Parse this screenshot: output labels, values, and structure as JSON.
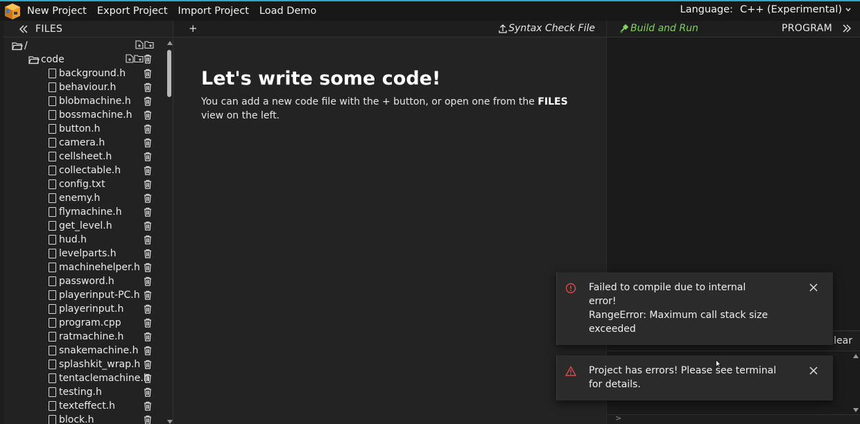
{
  "menu": {
    "items": [
      "New Project",
      "Export Project",
      "Import Project",
      "Load Demo"
    ],
    "language_label": "Language:",
    "language_value": "C++ (Experimental)"
  },
  "files_panel": {
    "title": "FILES",
    "root": "/",
    "folder": "code",
    "files": [
      "background.h",
      "behaviour.h",
      "blobmachine.h",
      "bossmachine.h",
      "button.h",
      "camera.h",
      "cellsheet.h",
      "collectable.h",
      "config.txt",
      "enemy.h",
      "flymachine.h",
      "get_level.h",
      "hud.h",
      "levelparts.h",
      "machinehelper.h",
      "password.h",
      "playerinput-PC.h",
      "playerinput.h",
      "program.cpp",
      "ratmachine.h",
      "snakemachine.h",
      "splashkit_wrap.h",
      "tentaclemachine.h",
      "testing.h",
      "texteffect.h",
      "block.h"
    ]
  },
  "editor": {
    "add_tab": "+",
    "syntax_check": "Syntax Check File",
    "welcome_title": "Let's write some code!",
    "welcome_text_1": "You can add a new code file with the + button, or open one from the ",
    "welcome_text_bold": "FILES",
    "welcome_text_2": " view on the left."
  },
  "program_panel": {
    "build_run": "Build and Run",
    "title": "PROGRAM",
    "clear_partial": "lear"
  },
  "toasts": [
    {
      "type": "error",
      "lines": [
        "Failed to compile due to internal",
        "error!",
        "RangeError: Maximum call stack size",
        "exceeded"
      ]
    },
    {
      "type": "warning",
      "lines": [
        "Project has errors! Please see terminal",
        "for details."
      ]
    }
  ],
  "colors": {
    "accent_top": "#2aa9c9",
    "build_green": "#7fd35d",
    "error_red": "#e04848",
    "warn_red": "#e04848"
  }
}
